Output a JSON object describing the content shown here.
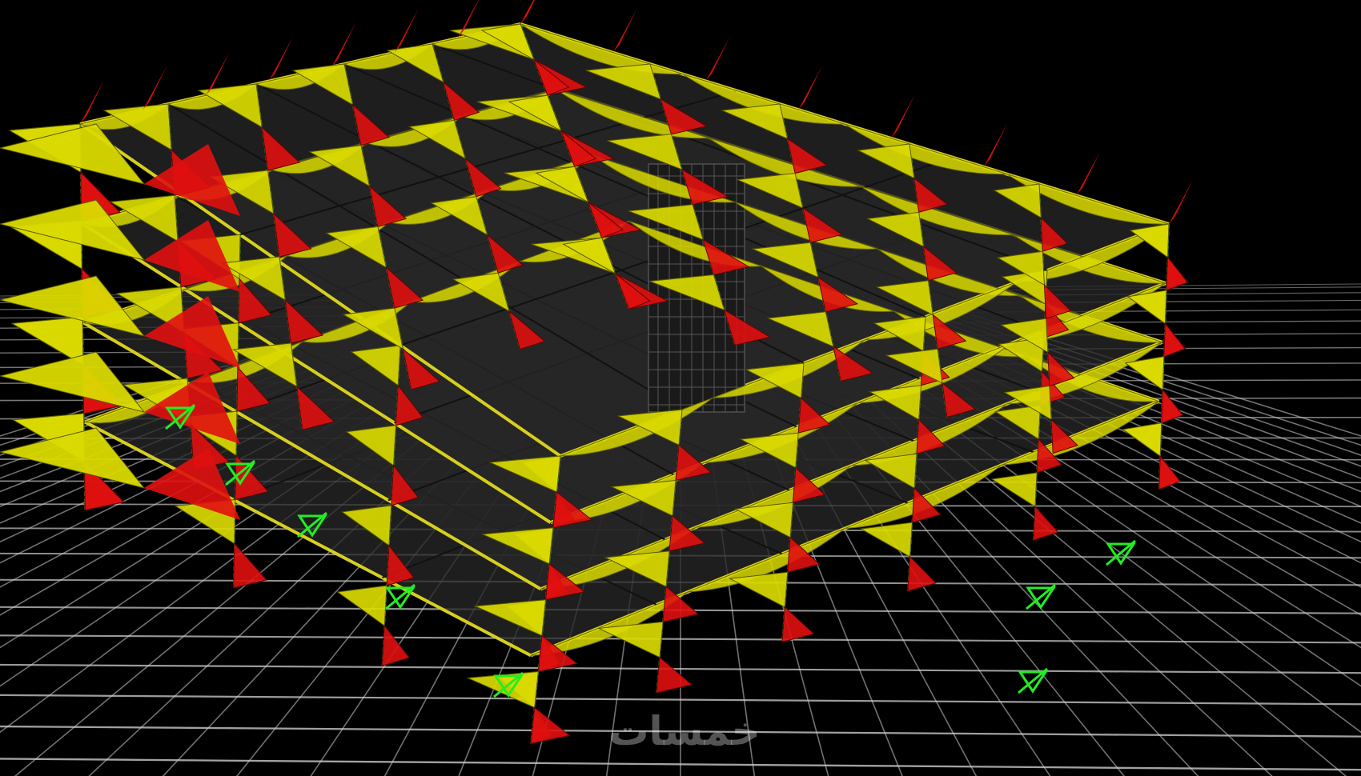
{
  "watermark": {
    "text": "خمسات"
  },
  "scene": {
    "floor_levels": 4,
    "colors": {
      "background": "#000000",
      "ground_grid": "#cfcfcf",
      "slab_fill": "#262626",
      "slab_edge": "#d6cf1e",
      "moment_positive": "#dada00",
      "moment_negative": "#e01010",
      "column_line": "#33cc33",
      "support": "#22ee22",
      "core": "#1a1a1a"
    }
  }
}
